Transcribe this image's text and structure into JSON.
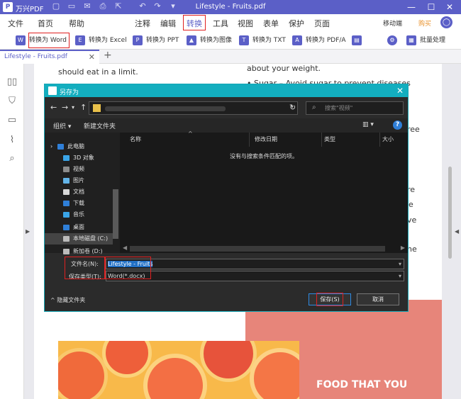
{
  "app": {
    "name": "万兴PDF",
    "doc_title": "Lifestyle - Fruits.pdf",
    "buttons": {
      "mobile": "移动端",
      "buy": "购买",
      "user": "人"
    },
    "title_icons": [
      "new-icon",
      "open-icon",
      "mail-icon",
      "print-icon",
      "share-icon",
      "undo-icon",
      "redo-icon",
      "dropdown-icon"
    ]
  },
  "menu": {
    "items": [
      "文件",
      "首页",
      "帮助",
      "注释",
      "编辑",
      "转换",
      "工具",
      "视图",
      "表单",
      "保护",
      "页面"
    ],
    "active": "转换"
  },
  "toolbar": {
    "items": [
      "转换为 Word",
      "转换为 Excel",
      "转换为 PPT",
      "转换为图像",
      "转换为 TXT",
      "转换为 PDF/A",
      "批量处理"
    ]
  },
  "tabs": {
    "active_label": "Lifestyle - Fruits.pdf"
  },
  "document": {
    "text1": "should eat in a limit.",
    "text2": "about your weight.",
    "text3": "• Sugar – Avoid sugar to prevent diseases",
    "side_frag": [
      "ree",
      "re",
      "e",
      "ve",
      "he"
    ],
    "food_text": "FOOD THAT YOU"
  },
  "dialog": {
    "title": "另存为",
    "search_placeholder": "搜索\"视频\"",
    "organize": "组织 ▾",
    "new_folder": "新建文件夹",
    "nav_items": [
      {
        "label": "此电脑",
        "color": "#2f7fd8"
      },
      {
        "label": "3D 对象",
        "color": "#3aa5e8"
      },
      {
        "label": "视频",
        "color": "#8c8c8c"
      },
      {
        "label": "图片",
        "color": "#63b4e8"
      },
      {
        "label": "文档",
        "color": "#d8d8d8"
      },
      {
        "label": "下载",
        "color": "#2f7fd8"
      },
      {
        "label": "音乐",
        "color": "#3aa5e8"
      },
      {
        "label": "桌面",
        "color": "#2f7fd8"
      },
      {
        "label": "本地磁盘 (C:)",
        "color": "#bbbbbb"
      },
      {
        "label": "新加卷 (D:)",
        "color": "#bbbbbb"
      }
    ],
    "columns": [
      "名称",
      "修改日期",
      "类型",
      "大小"
    ],
    "empty_message": "没有与搜索条件匹配的项。",
    "filename_label": "文件名(N):",
    "filename_value": "Lifestyle - Fruits",
    "filetype_label": "保存类型(T):",
    "filetype_value": "Word(*.docx)",
    "hide_folders": "隐藏文件夹",
    "save": "保存(S)",
    "cancel": "取消"
  }
}
